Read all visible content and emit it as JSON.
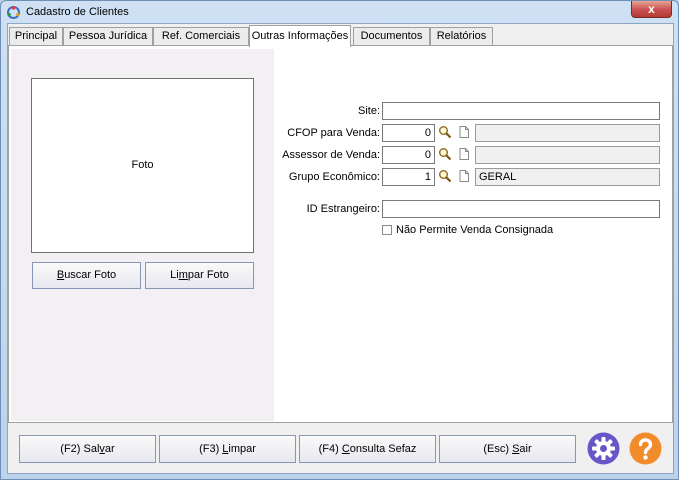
{
  "window": {
    "title": "Cadastro de Clientes",
    "close_glyph": "x"
  },
  "tabs": [
    {
      "label": "Principal",
      "active": false
    },
    {
      "label": "Pessoa Jurídica",
      "active": false
    },
    {
      "label": "Ref. Comerciais",
      "active": false
    },
    {
      "label": "Outras Informações",
      "active": true
    },
    {
      "label": "Documentos",
      "active": false
    },
    {
      "label": "Relatórios",
      "active": false
    }
  ],
  "photo": {
    "label": "Foto",
    "buscar": {
      "u": "B",
      "rest": "uscar Foto"
    },
    "limpar": {
      "pre": "Li",
      "u": "m",
      "rest": "par Foto"
    }
  },
  "form": {
    "site": {
      "label": "Site:",
      "value": ""
    },
    "cfop": {
      "label": "CFOP para Venda:",
      "value": "0",
      "desc": ""
    },
    "assessor": {
      "label": "Assessor de Venda:",
      "value": "0",
      "desc": ""
    },
    "grupo": {
      "label": "Grupo Econômico:",
      "value": "1",
      "desc": "GERAL"
    },
    "id_estrangeiro": {
      "label": "ID Estrangeiro:",
      "value": ""
    },
    "consignada": {
      "label": "Não Permite Venda Consignada",
      "checked": false
    }
  },
  "footer": {
    "salvar": {
      "pre": "(F2) Sal",
      "u": "v",
      "rest": "ar"
    },
    "limpar": {
      "pre": "(F3) ",
      "u": "L",
      "rest": "impar"
    },
    "sefaz": {
      "pre": "(F4) ",
      "u": "C",
      "rest": "onsulta Sefaz"
    },
    "sair": {
      "pre": "(Esc) ",
      "u": "S",
      "rest": "air"
    }
  },
  "icons": {
    "search": "magnifier-icon",
    "document": "document-icon",
    "settings": "gear-icon",
    "help": "help-icon"
  },
  "colors": {
    "accent_purple": "#6a55c8",
    "help_orange": "#f08c2b",
    "close_red": "#c75050"
  }
}
